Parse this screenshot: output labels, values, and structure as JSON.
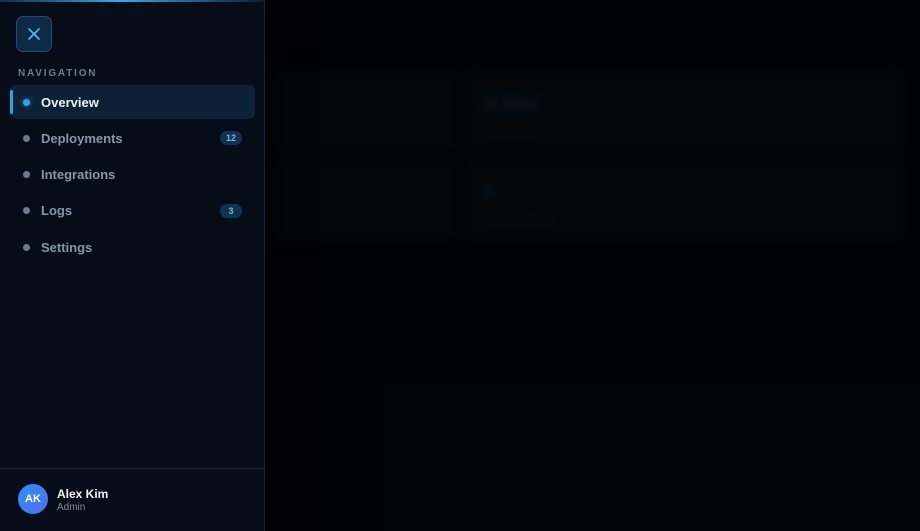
{
  "background": {
    "subtitle": "",
    "cards": [
      {
        "value": "",
        "label": ""
      },
      {
        "value": "4.2ms",
        "label": "Avg Latency"
      },
      {
        "value": "",
        "label": ""
      },
      {
        "value": "0",
        "label": "Active Incidents"
      }
    ]
  },
  "sidebar": {
    "nav_heading": "NAVIGATION",
    "items": [
      {
        "label": "Overview",
        "badge": "",
        "active": true
      },
      {
        "label": "Deployments",
        "badge": "12",
        "active": false
      },
      {
        "label": "Integrations",
        "badge": "",
        "active": false
      },
      {
        "label": "Logs",
        "badge": "3",
        "active": false
      },
      {
        "label": "Settings",
        "badge": "",
        "active": false
      }
    ],
    "user": {
      "initials": "AK",
      "name": "Alex Kim",
      "role": "Admin"
    }
  },
  "colors": {
    "accent": "#2ba3ec",
    "sidebar_bg": "#070d18",
    "badge_bg": "#123252"
  }
}
